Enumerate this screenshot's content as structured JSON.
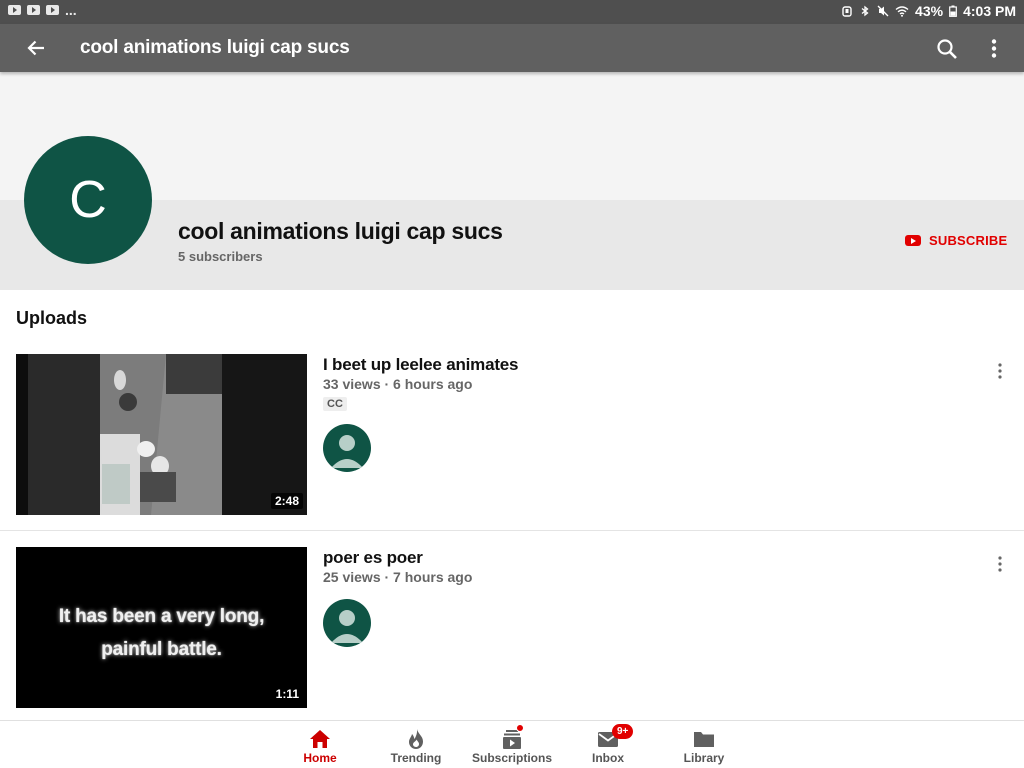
{
  "status_bar": {
    "time": "4:03 PM",
    "battery": "43%",
    "overflow": "..."
  },
  "app_bar": {
    "title": "cool animations luigi cap sucs"
  },
  "channel": {
    "avatar_letter": "C",
    "name": "cool animations luigi cap sucs",
    "subscribers": "5 subscribers",
    "subscribe_label": "SUBSCRIBE",
    "colors": {
      "avatar": "#0f5445",
      "subscribe": "#e10000"
    }
  },
  "uploads": {
    "heading": "Uploads",
    "videos": [
      {
        "title": "I beet up leelee animates",
        "meta": "33 views · 6 hours ago",
        "badge": "CC",
        "duration": "2:48"
      },
      {
        "title": "poer es poer",
        "meta": "25 views · 7 hours ago",
        "duration": "1:11",
        "thumb_caption_line1": "It has been a very long,",
        "thumb_caption_line2": "painful battle."
      }
    ]
  },
  "bottom_nav": {
    "items": [
      {
        "label": "Home",
        "icon": "home-icon",
        "active": true
      },
      {
        "label": "Trending",
        "icon": "flame-icon"
      },
      {
        "label": "Subscriptions",
        "icon": "subscriptions-icon"
      },
      {
        "label": "Inbox",
        "icon": "mail-icon",
        "badge": "9+"
      },
      {
        "label": "Library",
        "icon": "folder-icon"
      }
    ]
  }
}
